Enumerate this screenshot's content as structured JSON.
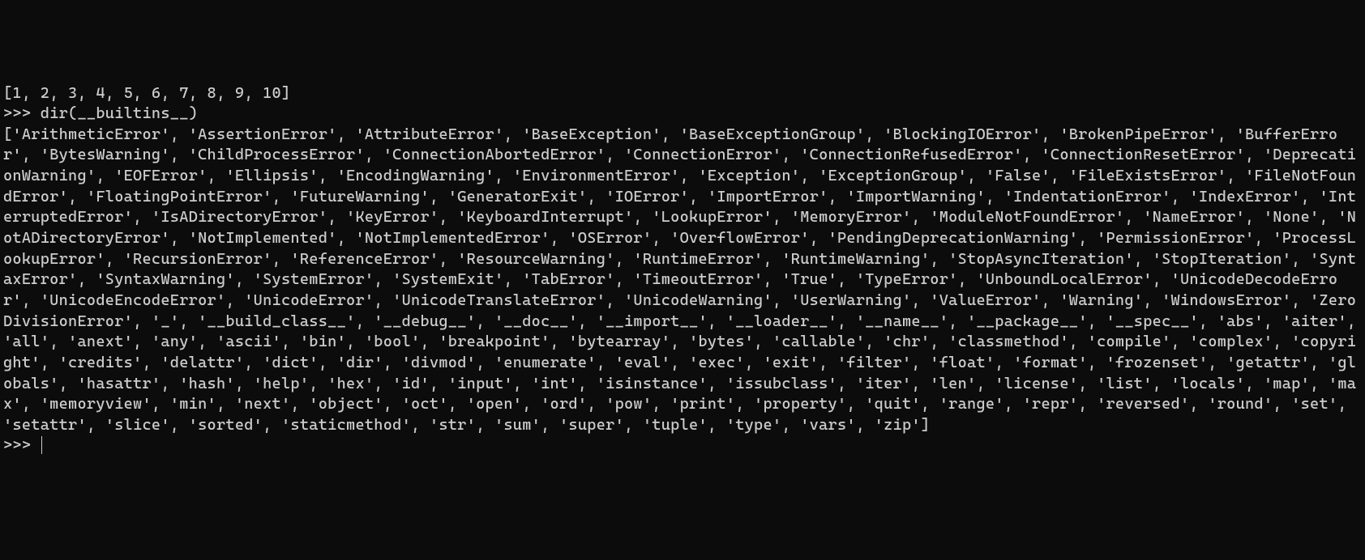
{
  "terminal": {
    "prev_output_tail": "[1, 2, 3, 4, 5, 6, 7, 8, 9, 10]",
    "prompt": ">>> ",
    "command": "dir(__builtins__)",
    "output_prefix": "[",
    "output_suffix": "]",
    "builtins": [
      "ArithmeticError",
      "AssertionError",
      "AttributeError",
      "BaseException",
      "BaseExceptionGroup",
      "BlockingIOError",
      "BrokenPipeError",
      "BufferError",
      "BytesWarning",
      "ChildProcessError",
      "ConnectionAbortedError",
      "ConnectionError",
      "ConnectionRefusedError",
      "ConnectionResetError",
      "DeprecationWarning",
      "EOFError",
      "Ellipsis",
      "EncodingWarning",
      "EnvironmentError",
      "Exception",
      "ExceptionGroup",
      "False",
      "FileExistsError",
      "FileNotFoundError",
      "FloatingPointError",
      "FutureWarning",
      "GeneratorExit",
      "IOError",
      "ImportError",
      "ImportWarning",
      "IndentationError",
      "IndexError",
      "InterruptedError",
      "IsADirectoryError",
      "KeyError",
      "KeyboardInterrupt",
      "LookupError",
      "MemoryError",
      "ModuleNotFoundError",
      "NameError",
      "None",
      "NotADirectoryError",
      "NotImplemented",
      "NotImplementedError",
      "OSError",
      "OverflowError",
      "PendingDeprecationWarning",
      "PermissionError",
      "ProcessLookupError",
      "RecursionError",
      "ReferenceError",
      "ResourceWarning",
      "RuntimeError",
      "RuntimeWarning",
      "StopAsyncIteration",
      "StopIteration",
      "SyntaxError",
      "SyntaxWarning",
      "SystemError",
      "SystemExit",
      "TabError",
      "TimeoutError",
      "True",
      "TypeError",
      "UnboundLocalError",
      "UnicodeDecodeError",
      "UnicodeEncodeError",
      "UnicodeError",
      "UnicodeTranslateError",
      "UnicodeWarning",
      "UserWarning",
      "ValueError",
      "Warning",
      "WindowsError",
      "ZeroDivisionError",
      "_",
      "__build_class__",
      "__debug__",
      "__doc__",
      "__import__",
      "__loader__",
      "__name__",
      "__package__",
      "__spec__",
      "abs",
      "aiter",
      "all",
      "anext",
      "any",
      "ascii",
      "bin",
      "bool",
      "breakpoint",
      "bytearray",
      "bytes",
      "callable",
      "chr",
      "classmethod",
      "compile",
      "complex",
      "copyright",
      "credits",
      "delattr",
      "dict",
      "dir",
      "divmod",
      "enumerate",
      "eval",
      "exec",
      "exit",
      "filter",
      "float",
      "format",
      "frozenset",
      "getattr",
      "globals",
      "hasattr",
      "hash",
      "help",
      "hex",
      "id",
      "input",
      "int",
      "isinstance",
      "issubclass",
      "iter",
      "len",
      "license",
      "list",
      "locals",
      "map",
      "max",
      "memoryview",
      "min",
      "next",
      "object",
      "oct",
      "open",
      "ord",
      "pow",
      "print",
      "property",
      "quit",
      "range",
      "repr",
      "reversed",
      "round",
      "set",
      "setattr",
      "slice",
      "sorted",
      "staticmethod",
      "str",
      "sum",
      "super",
      "tuple",
      "type",
      "vars",
      "zip"
    ],
    "next_prompt": ">>> "
  }
}
